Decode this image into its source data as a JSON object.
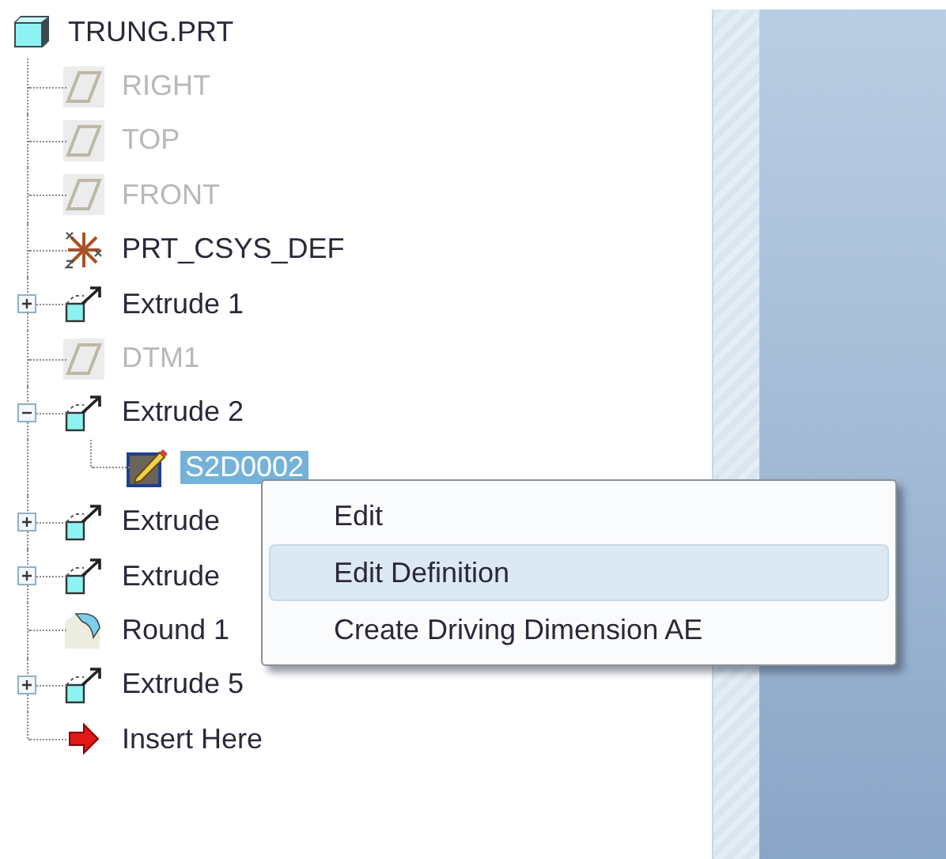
{
  "model_tree": {
    "label": "TRUNG.PRT",
    "kind": "part",
    "selected": false,
    "disabled": false,
    "children": [
      {
        "label": "RIGHT",
        "kind": "datum_plane",
        "selected": false,
        "disabled": true
      },
      {
        "label": "TOP",
        "kind": "datum_plane",
        "selected": false,
        "disabled": true
      },
      {
        "label": "FRONT",
        "kind": "datum_plane",
        "selected": false,
        "disabled": true
      },
      {
        "label": "PRT_CSYS_DEF",
        "kind": "csys",
        "selected": false,
        "disabled": false
      },
      {
        "label": "Extrude 1",
        "kind": "extrude",
        "selected": false,
        "disabled": false,
        "expanded": false
      },
      {
        "label": "DTM1",
        "kind": "datum_plane",
        "selected": false,
        "disabled": true
      },
      {
        "label": "Extrude 2",
        "kind": "extrude",
        "selected": false,
        "disabled": false,
        "expanded": true,
        "children": [
          {
            "label": "S2D0002",
            "kind": "sketch",
            "selected": true,
            "disabled": false
          }
        ]
      },
      {
        "label": "Extrude",
        "kind": "extrude",
        "selected": false,
        "disabled": false,
        "expanded": false
      },
      {
        "label": "Extrude",
        "kind": "extrude",
        "selected": false,
        "disabled": false,
        "expanded": false
      },
      {
        "label": "Round 1",
        "kind": "round",
        "selected": false,
        "disabled": false
      },
      {
        "label": "Extrude 5",
        "kind": "extrude",
        "selected": false,
        "disabled": false,
        "expanded": false
      },
      {
        "label": "Insert Here",
        "kind": "insert",
        "selected": false,
        "disabled": false
      }
    ]
  },
  "context_menu": {
    "items": [
      {
        "label": "Edit",
        "selected": false
      },
      {
        "label": "Edit Definition",
        "selected": true
      },
      {
        "label": "Create Driving Dimension AE",
        "selected": false
      }
    ]
  }
}
